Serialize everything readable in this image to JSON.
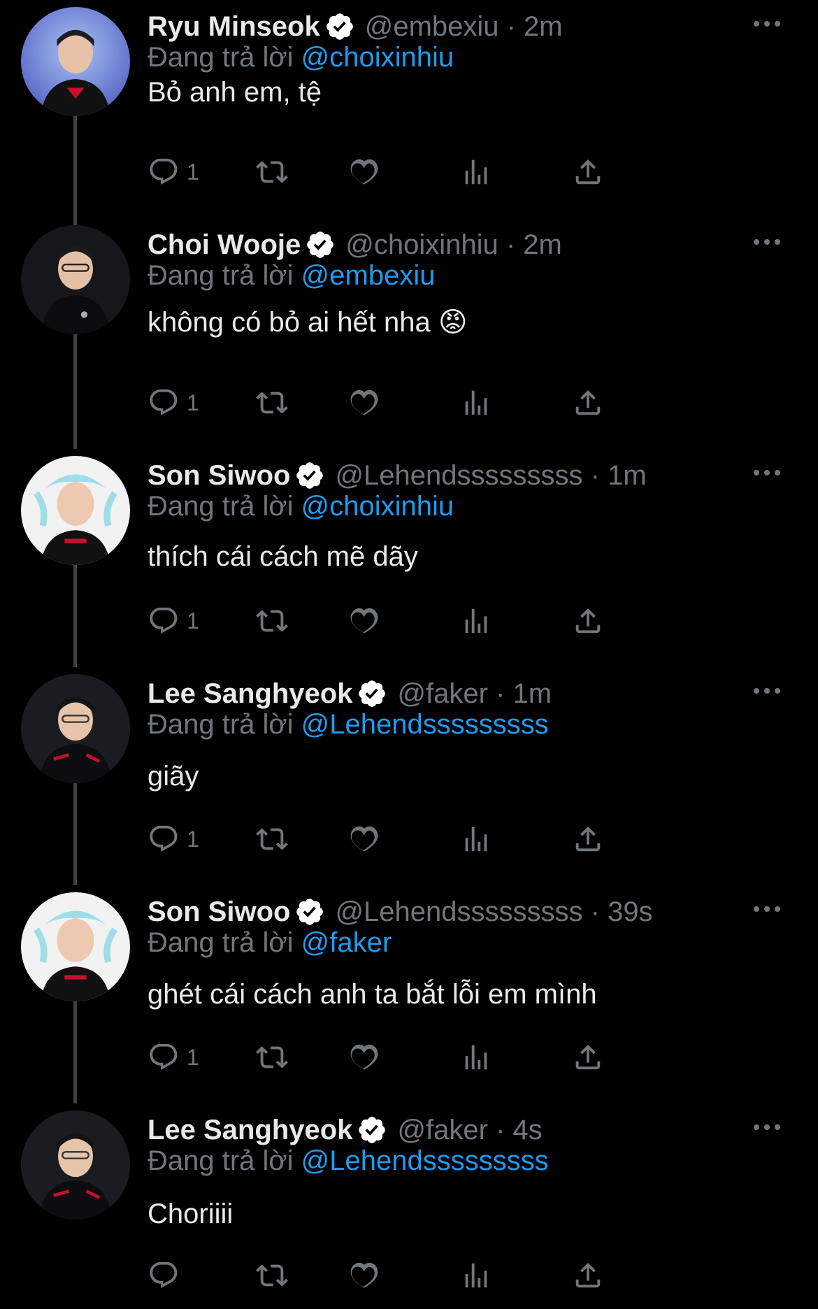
{
  "colors": {
    "background": "#000000",
    "text": "#e7e9ea",
    "secondary": "#71767b",
    "link": "#1d9bf0",
    "verified": "#ffffff"
  },
  "labels": {
    "replying_prefix": "Đang trả lời"
  },
  "icons": [
    "reply-icon",
    "retweet-icon",
    "like-icon",
    "views-icon",
    "share-icon",
    "more-icon",
    "verified-badge-icon"
  ],
  "tweets": [
    {
      "name": "Ryu Minseok",
      "handle": "@embexiu · 2m",
      "reply_to": "@choixinhiu",
      "text": "Bỏ anh em, tệ",
      "replies": "1",
      "avatar_theme": "cyan"
    },
    {
      "name": "Choi Wooje",
      "handle": "@choixinhiu · 2m",
      "reply_to": "@embexiu",
      "text": "không có bỏ ai hết nha 😡",
      "replies": "1",
      "avatar_theme": "dark"
    },
    {
      "name": "Son Siwoo",
      "handle": "@Lehendsssssssss · 1m",
      "reply_to": "@choixinhiu",
      "text": "thích cái cách mẽ dãy",
      "replies": "1",
      "avatar_theme": "light"
    },
    {
      "name": "Lee Sanghyeok",
      "handle": "@faker · 1m",
      "reply_to": "@Lehendsssssssss",
      "text": "giãy",
      "replies": "1",
      "avatar_theme": "dark"
    },
    {
      "name": "Son Siwoo",
      "handle": "@Lehendsssssssss · 39s",
      "reply_to": "@faker",
      "text": "ghét cái cách anh ta bắt lỗi em mình",
      "replies": "1",
      "avatar_theme": "light"
    },
    {
      "name": "Lee Sanghyeok",
      "handle": "@faker · 4s",
      "reply_to": "@Lehendsssssssss",
      "text": "Choriiii",
      "replies": "",
      "avatar_theme": "dark"
    }
  ]
}
